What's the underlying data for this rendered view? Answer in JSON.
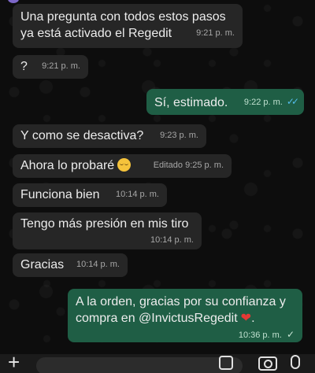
{
  "messages": [
    {
      "text_line1": "Una pregunta con todos estos pasos",
      "text_line2": "ya está activado el Regedit",
      "time": "9:21 p. m."
    },
    {
      "text": "?",
      "time": "9:21 p. m."
    },
    {
      "text": "Sí, estimado.",
      "time": "9:22 p. m."
    },
    {
      "text": "Y como se desactiva?",
      "time": "9:23 p. m."
    },
    {
      "text": "Ahora lo probaré",
      "edited_time": "Editado 9:25 p. m."
    },
    {
      "text": "Funciona bien",
      "time": "10:14 p. m."
    },
    {
      "text": "Tengo más presión en mis tiro",
      "time": "10:14 p. m."
    },
    {
      "text": "Gracias",
      "time": "10:14 p. m."
    },
    {
      "text_line1": "A la orden, gracias por su confianza y",
      "text_line2": "compra en @InvictusRegedit",
      "time": "10:36 p. m."
    }
  ],
  "icons": {
    "double_check": "✓✓",
    "single_check": "✓",
    "plus": "+"
  },
  "colors": {
    "incoming_bubble": "#262626",
    "outgoing_bubble": "#1f5e45",
    "read_ticks": "#53bdeb"
  }
}
